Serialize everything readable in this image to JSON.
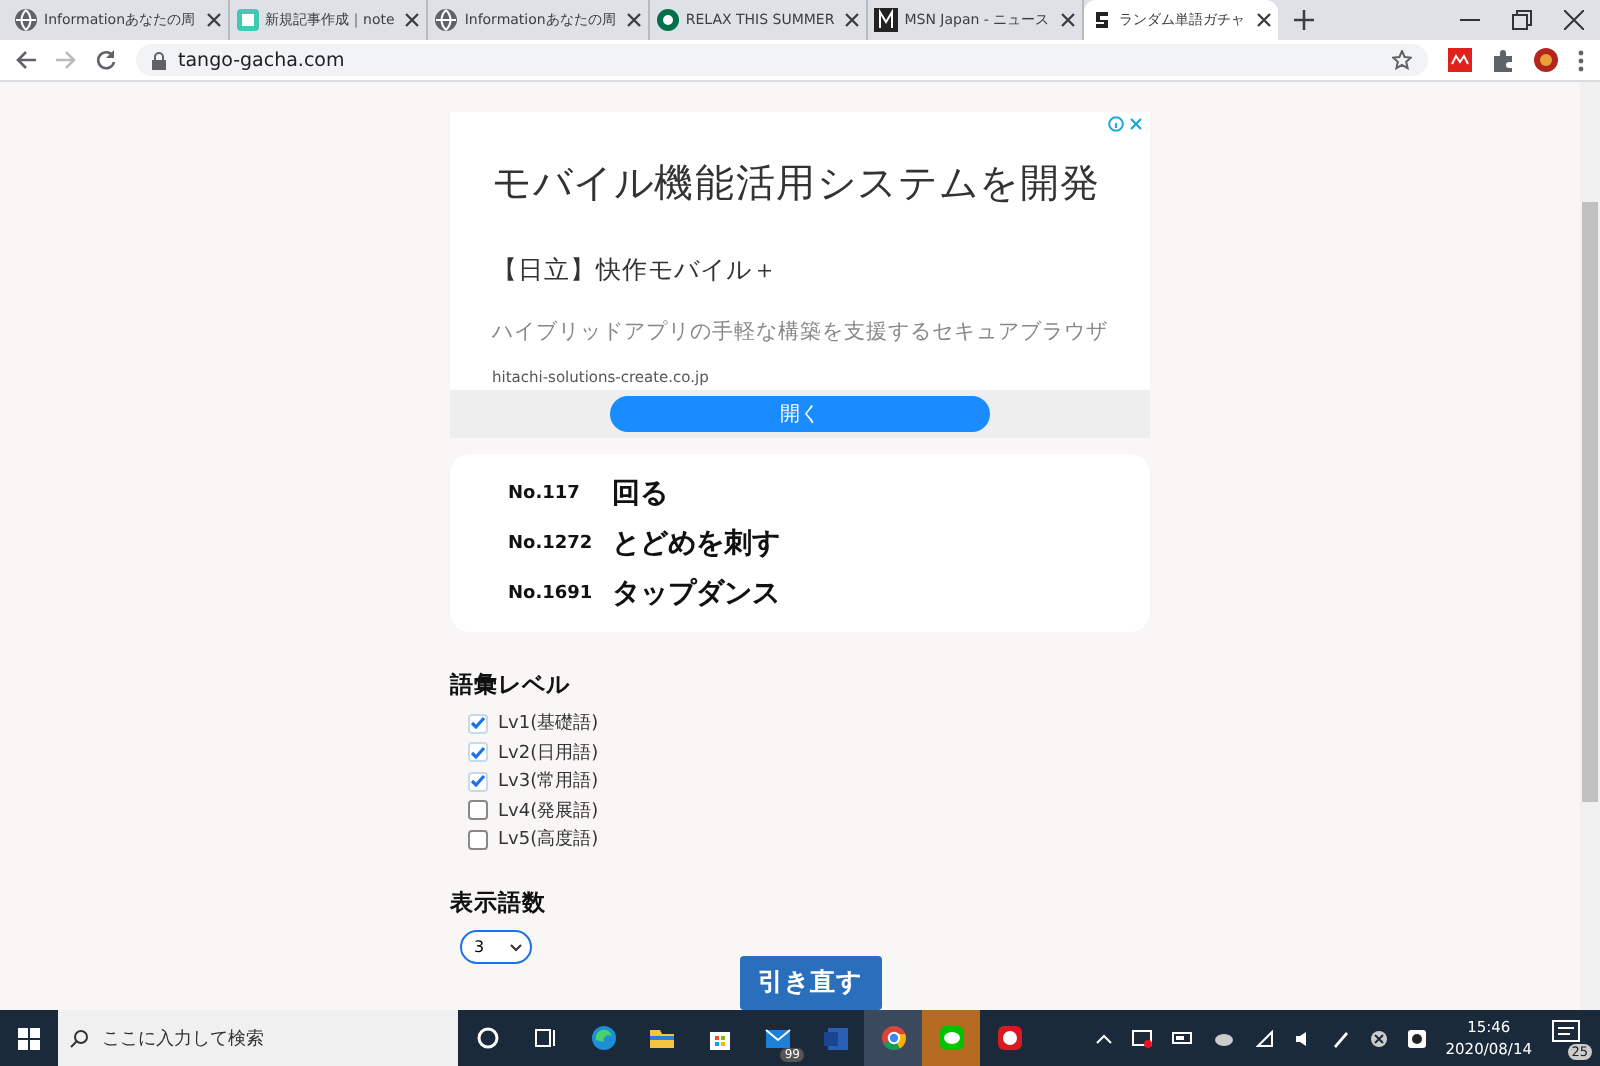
{
  "browser": {
    "tabs": [
      {
        "title": "Informationあなたの周",
        "selected": false
      },
      {
        "title": "新規記事作成｜note",
        "selected": false
      },
      {
        "title": "Informationあなたの周",
        "selected": false
      },
      {
        "title": "RELAX THIS SUMMER",
        "selected": false
      },
      {
        "title": "MSN Japan - ニュース",
        "selected": false
      },
      {
        "title": "ランダム単語ガチャ",
        "selected": true
      }
    ],
    "url": "tango-gacha.com"
  },
  "ad": {
    "headline": "モバイル機能活用システムを開発",
    "title": "【日立】快作モバイル＋",
    "description": "ハイブリッドアプリの手軽な構築を支援するセキュアブラウザ",
    "domain": "hitachi-solutions-create.co.jp",
    "button": "開く"
  },
  "words": [
    {
      "number": "No.117",
      "word": "回る"
    },
    {
      "number": "No.1272",
      "word": "とどめを刺す"
    },
    {
      "number": "No.1691",
      "word": "タップダンス"
    }
  ],
  "level_section": {
    "heading": "語彙レベル",
    "options": [
      {
        "label": "Lv1(基礎語)",
        "checked": true
      },
      {
        "label": "Lv2(日用語)",
        "checked": true
      },
      {
        "label": "Lv3(常用語)",
        "checked": true
      },
      {
        "label": "Lv4(発展語)",
        "checked": false
      },
      {
        "label": "Lv5(高度語)",
        "checked": false
      }
    ]
  },
  "count_section": {
    "heading": "表示語数",
    "value": "3"
  },
  "redraw_button": "引き直す",
  "taskbar": {
    "search_placeholder": "ここに入力して検索",
    "mail_badge": "99",
    "time": "15:46",
    "date": "2020/08/14",
    "notification_count": "25"
  }
}
